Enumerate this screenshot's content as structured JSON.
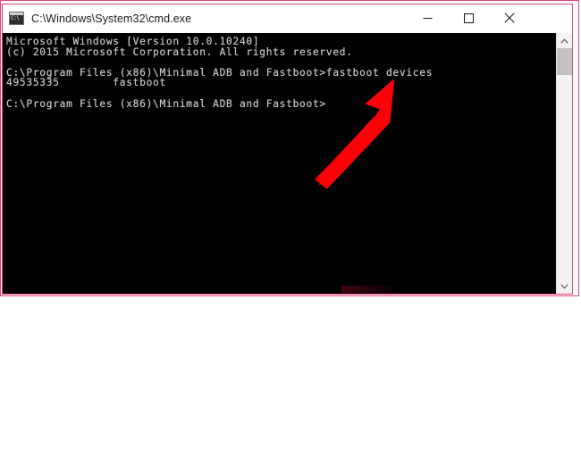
{
  "window": {
    "title": "C:\\Windows\\System32\\cmd.exe",
    "icon": "cmd-console-icon",
    "icon_glyph": "C:\\",
    "controls": {
      "minimize_label": "Minimize",
      "maximize_label": "Maximize",
      "close_label": "Close"
    }
  },
  "console": {
    "background_color": "#000000",
    "text_color": "#c8c8c8",
    "lines": [
      "Microsoft Windows [Version 10.0.10240]",
      "(c) 2015 Microsoft Corporation. All rights reserved.",
      "",
      "C:\\Program Files (x86)\\Minimal ADB and Fastboot>fastboot devices",
      "49535335        fastboot",
      "",
      "C:\\Program Files (x86)\\Minimal ADB and Fastboot>"
    ],
    "os_name": "Microsoft Windows",
    "os_version": "10.0.10240",
    "copyright": "(c) 2015 Microsoft Corporation. All rights reserved.",
    "prompt_path": "C:\\Program Files (x86)\\Minimal ADB and Fastboot>",
    "command": "fastboot devices",
    "device_serial": "49535335",
    "device_mode": "fastboot"
  },
  "scrollbar": {
    "up_arrow": "chevron-up-icon",
    "down_arrow": "chevron-down-icon",
    "thumb_label": "scroll-thumb"
  },
  "annotation": {
    "arrow_color": "#fb0007",
    "arrow_label": "red-pointer-arrow",
    "points_to": "fastboot devices",
    "border_color": "#e0457b"
  }
}
